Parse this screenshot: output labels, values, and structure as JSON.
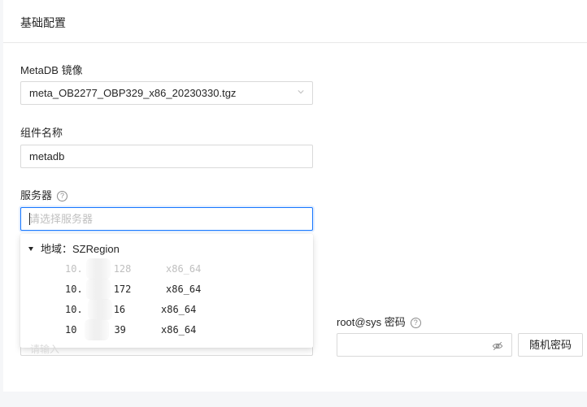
{
  "section": {
    "title": "基础配置"
  },
  "metadb_image": {
    "label": "MetaDB 镜像",
    "value": "meta_OB2277_OBP329_x86_20230330.tgz"
  },
  "component_name": {
    "label": "组件名称",
    "value": "metadb"
  },
  "servers": {
    "label": "服务器",
    "placeholder": "请选择服务器",
    "dropdown": {
      "region": "地域：SZRegion",
      "options": [
        {
          "ip": "10.",
          "ip_tail": "128",
          "arch": "x86_64",
          "disabled": true
        },
        {
          "ip": "10.",
          "ip_tail": "172",
          "arch": "x86_64",
          "disabled": false
        },
        {
          "ip": "10.",
          "ip_tail": "16",
          "arch": "x86_64",
          "disabled": false
        },
        {
          "ip": "10",
          "ip_tail": "39",
          "arch": "x86_64",
          "disabled": false
        }
      ]
    }
  },
  "hidden_field": {
    "placeholder_fragment": "请输入"
  },
  "root_password": {
    "label": "root@sys 密码",
    "value": "",
    "random_button": "随机密码"
  },
  "colors": {
    "accent": "#1677ff",
    "border": "#d9d9d9",
    "disabled_text": "#bfbfbf"
  }
}
